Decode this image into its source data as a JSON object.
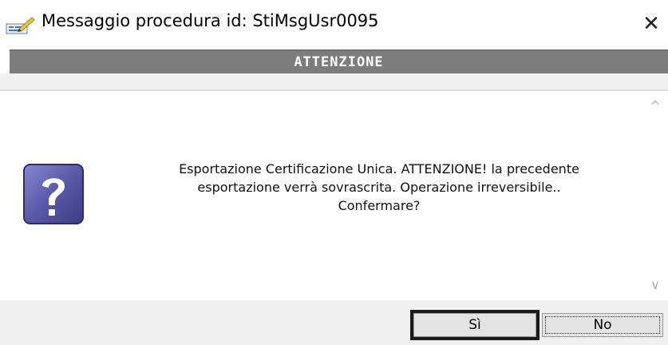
{
  "window": {
    "title": "Messaggio procedura id: StiMsgUsr0095",
    "close_glyph": "✕",
    "app_icon": "edit-document-icon"
  },
  "header": {
    "title": "ATTENZIONE",
    "band_color": "#7c7c7c"
  },
  "message": {
    "icon": "question-mark-icon",
    "lines": [
      "Esportazione Certificazione Unica. ATTENZIONE! la precedente",
      "esportazione verrà sovrascrita. Operazione irreversibile..",
      "Confermare?"
    ]
  },
  "scrollbar": {
    "up_glyph": "^",
    "down_glyph": "∨"
  },
  "buttons": {
    "yes_label": "Sì",
    "no_label": "No"
  }
}
